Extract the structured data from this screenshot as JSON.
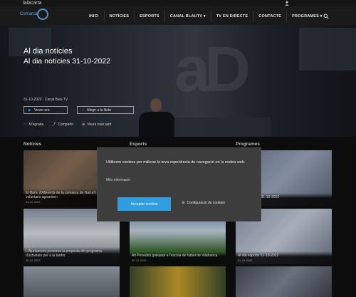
{
  "topbar": {
    "brand": "lalacarta"
  },
  "logo": {
    "text": "Comarca"
  },
  "nav": {
    "items": [
      "INICI",
      "NOTÍCIES",
      "ESPORTS",
      "CANAL BLAUTV ▾",
      "TV EN DIRECTE",
      "CONTACTE",
      "PROGRAMES ▾"
    ]
  },
  "hero": {
    "title": "Al dia notícies",
    "subtitle": "Al dia notícies 31-10-2022",
    "meta": "31-10-2022 · Canal Blau TV",
    "btn_play": "Veure ara",
    "btn_play_icon": "▶",
    "btn_add": "Afegir a la llista",
    "btn_add_icon": "+",
    "link_like": "M'agrada",
    "link_like_icon": "♡",
    "link_share": "Compartir",
    "link_share_icon": "⤴",
    "link_more": "Veure més tard",
    "link_more_icon": "⊕"
  },
  "sections": {
    "news": "Notícies",
    "sports": "Esports",
    "programs": "Programes"
  },
  "cards": [
    {
      "title": "El Banc d'Aliments de la comarca de Garraf i els seus voluntaris agraeixen",
      "date": "31-10-2022"
    },
    {
      "title": "Al dia notícies 31-10-2022",
      "date": "31-10-2022"
    },
    {
      "title": "L'Ajuntament presenta la proposta del programa d'activitats per a la tardor",
      "date": "30-10-2022"
    },
    {
      "title": "Alt Penedès golejada a l'escola de futbol de Vilafranca",
      "date": "30-10-2022"
    },
    {
      "title": "Al dia esports 31-10-2022",
      "date": "31-10-2022"
    }
  ],
  "cookie": {
    "text": "Utilitzem cookies per millorar la teva experiència de navegació en la nostra web.",
    "more": "Més informació",
    "accept": "Acceptar cookies",
    "config": "Configuració de cookies",
    "config_icon": "⚙"
  },
  "colors": {
    "accent": "#2f9de0",
    "nav_bg": "#1a1a1a",
    "modal_bg": "#3d3d3d"
  }
}
